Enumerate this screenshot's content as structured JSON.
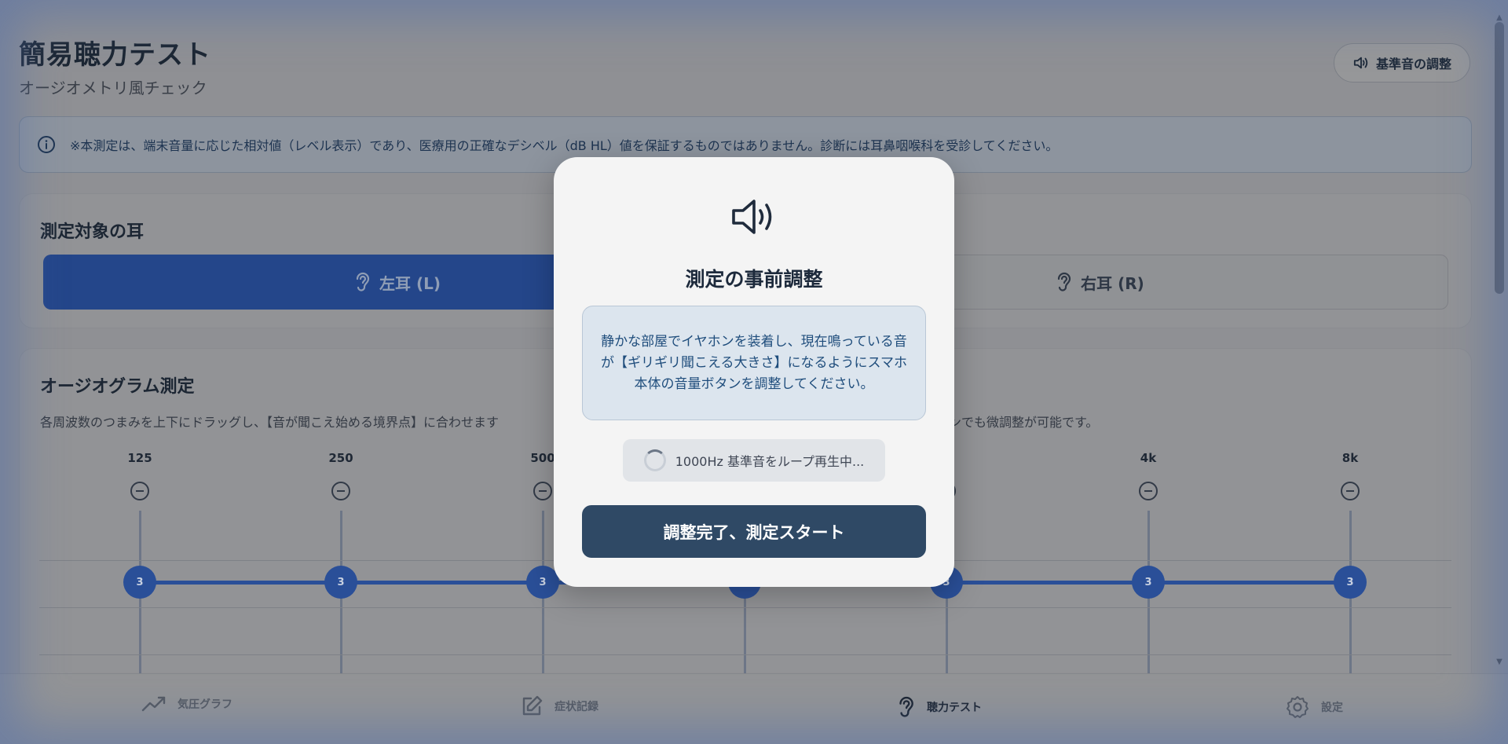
{
  "header": {
    "title": "簡易聴力テスト",
    "subtitle": "オージオメトリ風チェック",
    "calibrate_label": "基準音の調整"
  },
  "notice": {
    "text": "※本測定は、端末音量に応じた相対値（レベル表示）であり、医療用の正確なデシベル（dB HL）値を保証するものではありません。診断には耳鼻咽喉科を受診してください。"
  },
  "ear_card": {
    "title": "測定対象の耳",
    "left_label": "左耳 (L)",
    "right_label": "右耳 (R)",
    "selected": "left"
  },
  "audiogram_card": {
    "title": "オージオグラム測定",
    "description": "各周波数のつまみを上下にドラッグし、【音が聞こえ始める境界点】に合わせます",
    "description_tail": "ンでも微調整が可能です。",
    "frequencies": [
      {
        "label": "125",
        "level": "3"
      },
      {
        "label": "250",
        "level": "3"
      },
      {
        "label": "500",
        "level": "3"
      },
      {
        "label": "",
        "level": "3"
      },
      {
        "label": "",
        "level": "3"
      },
      {
        "label": "4k",
        "level": "3"
      },
      {
        "label": "8k",
        "level": "3"
      }
    ]
  },
  "bottom_nav": {
    "items": [
      {
        "label": "気圧グラフ",
        "icon": "trend-icon"
      },
      {
        "label": "症状記録",
        "icon": "edit-icon"
      },
      {
        "label": "聴力テスト",
        "icon": "ear-icon",
        "active": true
      },
      {
        "label": "設定",
        "icon": "gear-icon"
      }
    ]
  },
  "modal": {
    "title": "測定の事前調整",
    "info": "静かな部屋でイヤホンを装着し、現在鳴っている音が【ギリギリ聞こえる大きさ】になるようにスマホ本体の音量ボタンを調整してください。",
    "loop_status": "1000Hz 基準音をループ再生中...",
    "start_label": "調整完了、測定スタート"
  },
  "colors": {
    "accent": "#2a4f98",
    "modal_button": "#2f4965",
    "info_bg": "#dce5ee"
  }
}
